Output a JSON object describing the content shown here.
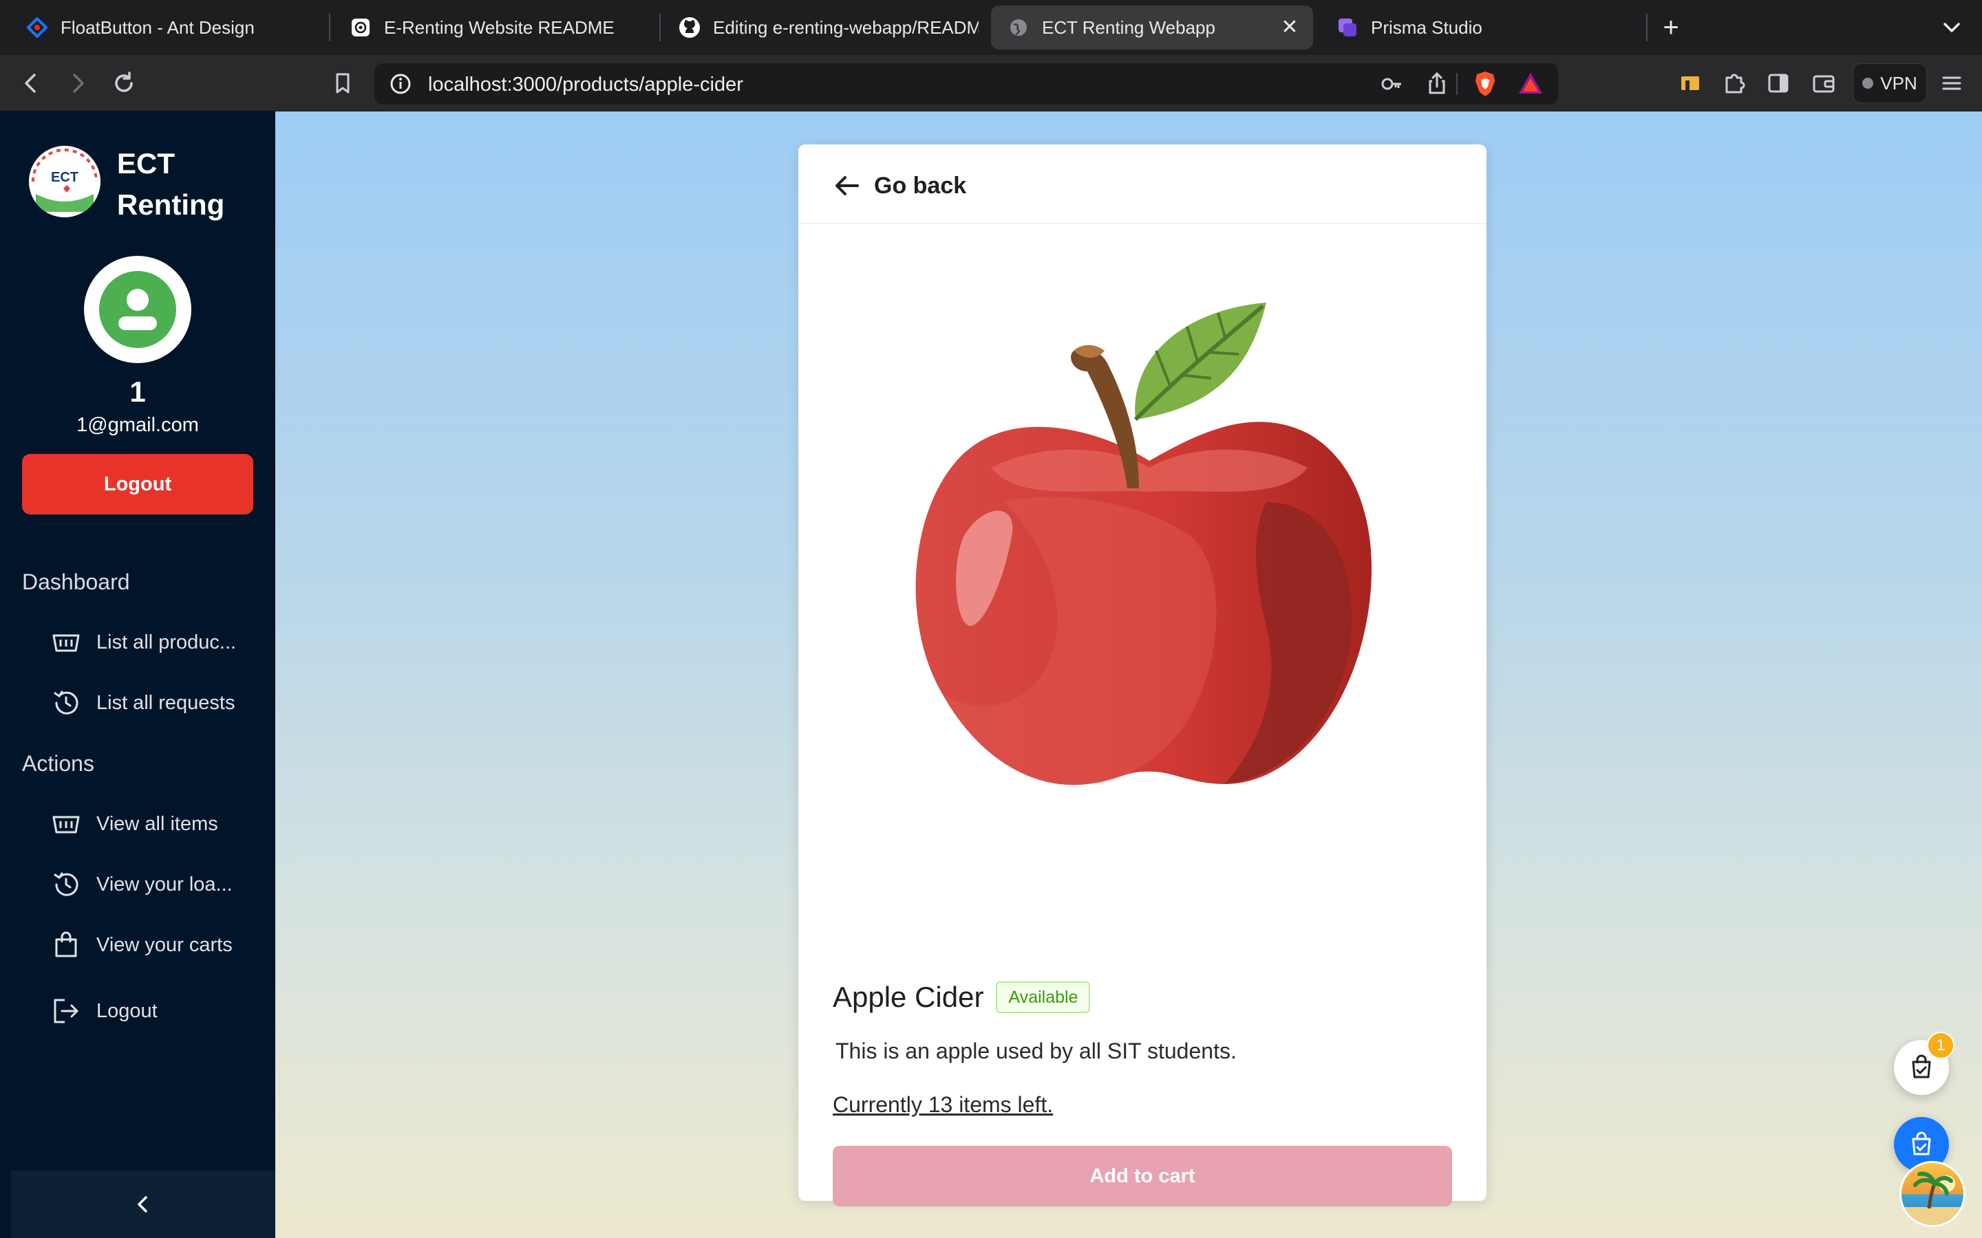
{
  "browser": {
    "tabs": [
      {
        "label": "FloatButton - Ant Design",
        "icon": "ant-design-icon"
      },
      {
        "label": "E-Renting Website README",
        "icon": "openai-icon"
      },
      {
        "label": "Editing e-renting-webapp/READM",
        "icon": "github-icon"
      },
      {
        "label": "ECT Renting Webapp",
        "icon": "globe-icon",
        "active": true
      },
      {
        "label": "Prisma Studio",
        "icon": "prisma-icon"
      }
    ],
    "close_glyph": "✕",
    "new_tab_glyph": "+",
    "url_host": "localhost",
    "url_path": ":3000/products/apple-cider",
    "vpn_label": "VPN"
  },
  "sidebar": {
    "brand": "ECT Renting",
    "logo_text": "ECT",
    "user_name": "1",
    "user_email": "1@gmail.com",
    "logout_button": "Logout",
    "sections": [
      {
        "title": "Dashboard",
        "items": [
          {
            "label": "List all produc...",
            "icon": "basket-icon"
          },
          {
            "label": "List all requests",
            "icon": "history-icon"
          }
        ]
      },
      {
        "title": "Actions",
        "items": [
          {
            "label": "View all items",
            "icon": "basket-icon"
          },
          {
            "label": "View your loa...",
            "icon": "history-icon"
          },
          {
            "label": "View your carts",
            "icon": "shopping-bag-icon"
          },
          {
            "label": "Logout",
            "icon": "logout-icon"
          }
        ]
      }
    ],
    "collapse_glyph": "‹"
  },
  "product": {
    "go_back": "Go back",
    "name": "Apple Cider",
    "status": "Available",
    "description": "This is an apple used by all SIT students.",
    "stock_text": "Currently 13 items left.",
    "add_to_cart": "Add to cart"
  },
  "float_buttons": {
    "cart_badge": "1"
  },
  "colors": {
    "sidebar_bg": "#001529",
    "logout_red": "#e8332a",
    "available_green": "#389e0d",
    "add_to_cart_pink": "#e8a3b0",
    "primary_blue": "#1677ff"
  }
}
